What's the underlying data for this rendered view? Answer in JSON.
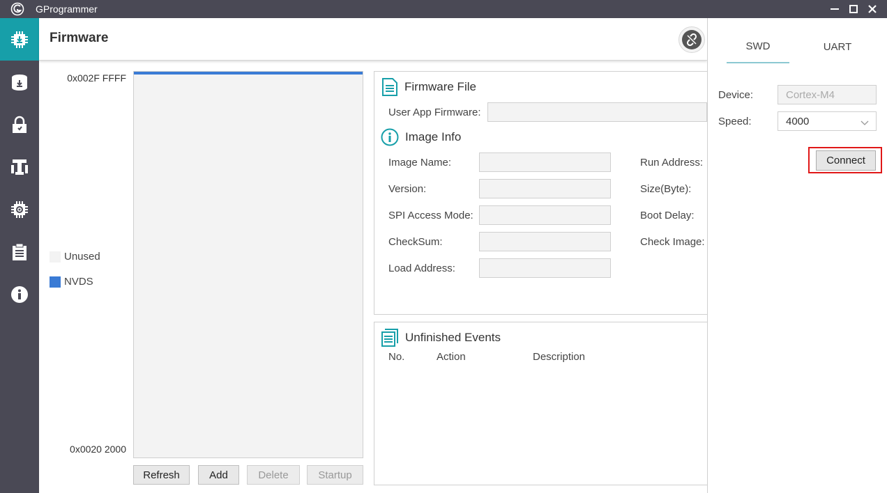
{
  "window": {
    "title": "GProgrammer"
  },
  "sidebar": {
    "items": [
      {
        "icon": "chip-download-icon",
        "active": true
      },
      {
        "icon": "database-download-icon"
      },
      {
        "icon": "lock-icon"
      },
      {
        "icon": "tools-icon"
      },
      {
        "icon": "chip-gear-icon"
      },
      {
        "icon": "clipboard-icon"
      },
      {
        "icon": "info-icon"
      }
    ]
  },
  "header": {
    "title": "Firmware"
  },
  "memory": {
    "top_address": "0x002F FFFF",
    "bottom_address": "0x0020 2000",
    "legend": [
      {
        "label": "Unused",
        "color": "#f3f3f3"
      },
      {
        "label": "NVDS",
        "color": "#3a7bd5"
      }
    ],
    "buttons": {
      "refresh": "Refresh",
      "add": "Add",
      "delete": "Delete",
      "startup": "Startup"
    }
  },
  "firmware_file": {
    "title": "Firmware File",
    "user_app_label": "User App Firmware:"
  },
  "image_info": {
    "title": "Image Info",
    "left_labels": [
      "Image Name:",
      "Version:",
      "SPI Access Mode:",
      "CheckSum:",
      "Load Address:"
    ],
    "right_labels": [
      "Run Address:",
      "Size(Byte):",
      "Boot Delay:",
      "Check Image:"
    ]
  },
  "events": {
    "title": "Unfinished Events",
    "columns": [
      "No.",
      "Action",
      "Description"
    ]
  },
  "connection": {
    "tabs": [
      "SWD",
      "UART"
    ],
    "device_label": "Device:",
    "device_value": "Cortex-M4",
    "speed_label": "Speed:",
    "speed_value": "4000",
    "connect_label": "Connect"
  }
}
